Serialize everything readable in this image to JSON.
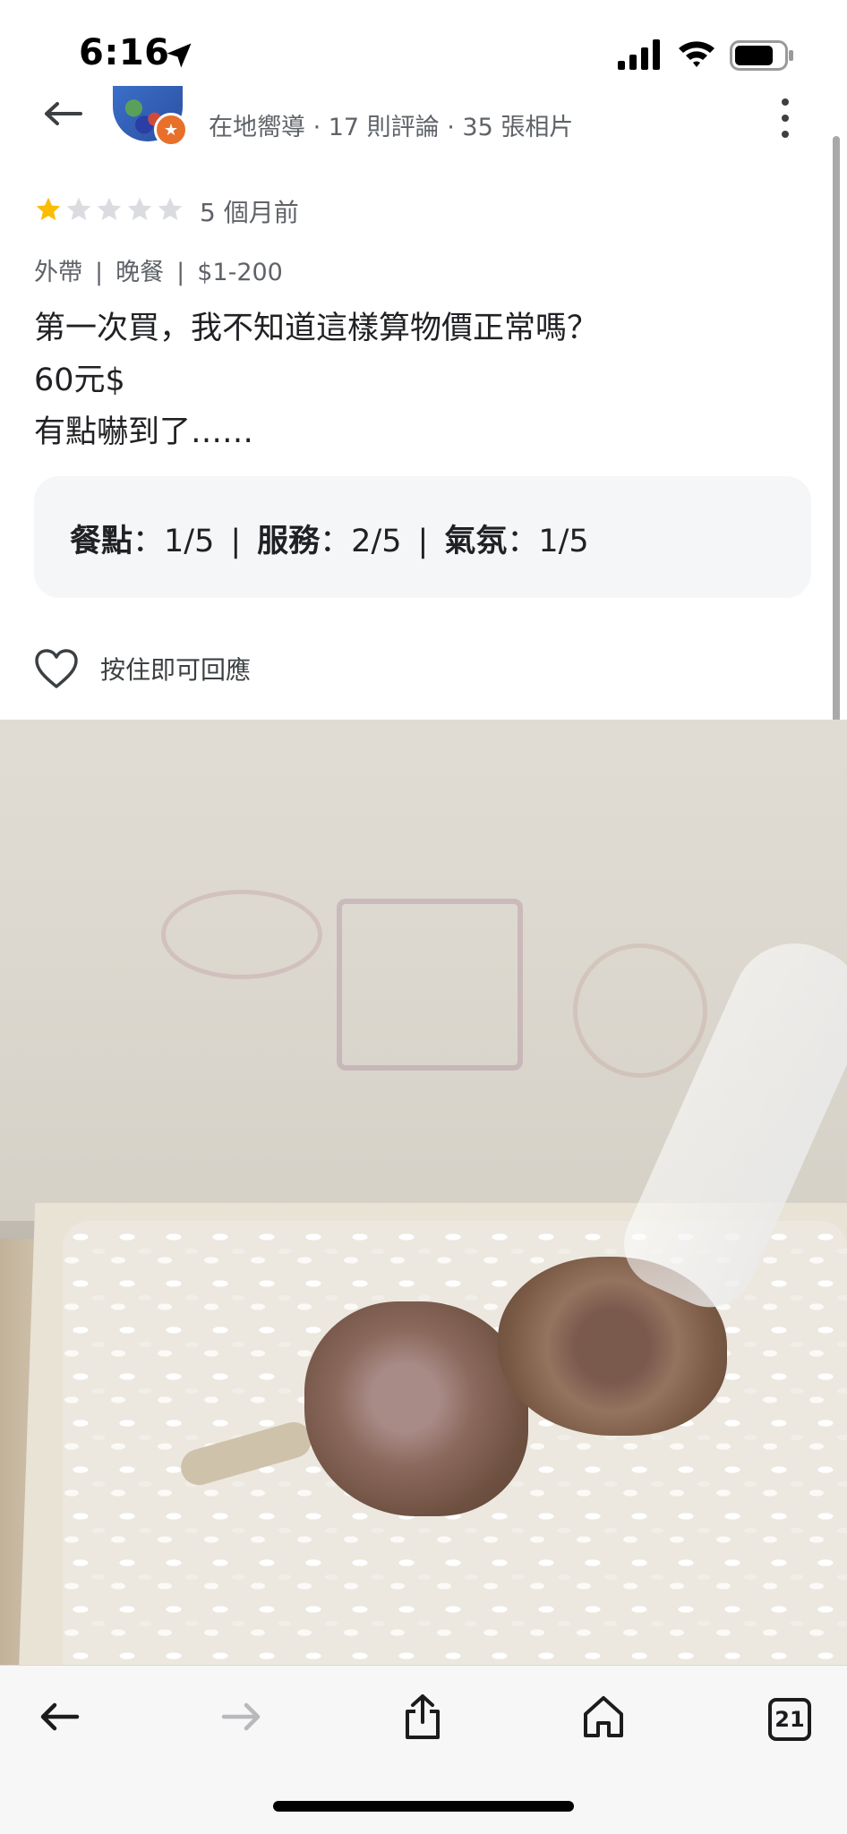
{
  "status_bar": {
    "time": "6:16"
  },
  "reviewer": {
    "meta": "在地嚮導 · 17 則評論 · 35 張相片"
  },
  "review": {
    "rating": 1,
    "max_rating": 5,
    "time_ago": "5 個月前",
    "tags": [
      "外帶",
      "晚餐",
      "$1-200"
    ],
    "tag_separator": "|",
    "text_lines": [
      "第一次買，我不知道這樣算物價正常嗎？",
      "60元$",
      "有點嚇到了……"
    ],
    "sub_ratings": [
      {
        "label": "餐點",
        "value": "：1/5"
      },
      {
        "label": "服務",
        "value": "：2/5"
      },
      {
        "label": "氣氛",
        "value": "：1/5"
      }
    ],
    "sub_rating_separator": "|",
    "like_hint": "按住即可回應"
  },
  "toolbar": {
    "tabs_count": "21"
  },
  "colors": {
    "star_filled": "#fbbc04",
    "star_empty": "#dadce0",
    "local_guide_badge": "#e8702a"
  },
  "icons": [
    "back-arrow-icon",
    "more-vert-icon",
    "heart-icon",
    "share-icon",
    "home-icon",
    "forward-arrow-icon",
    "tabs-icon"
  ]
}
